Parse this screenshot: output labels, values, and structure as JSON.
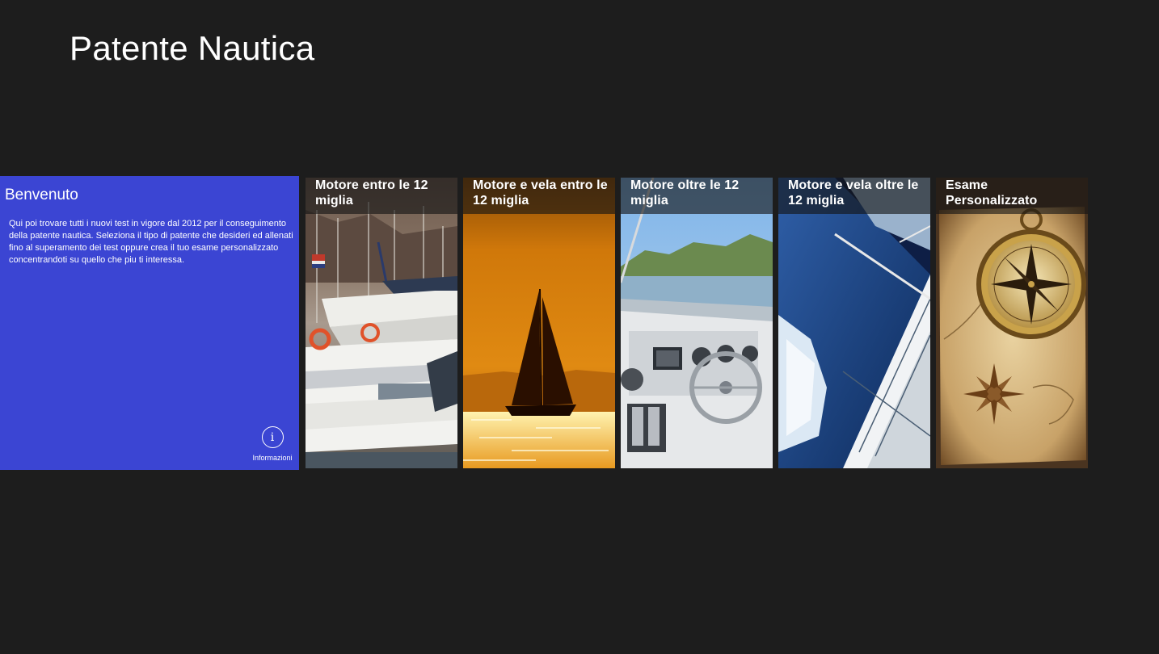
{
  "app": {
    "title": "Patente Nautica"
  },
  "welcome": {
    "title": "Benvenuto",
    "text": "Qui poi trovare tutti i nuovi test in vigore dal 2012 per il conseguimento della patente nautica. Seleziona il tipo di patente che desideri ed allenati fino al superamento dei test oppure crea il tuo esame personalizzato concentrandoti su quello che piu ti interessa.",
    "info_label": "Informazioni",
    "info_glyph": "i",
    "background_color": "#3b45d3"
  },
  "tiles": [
    {
      "label": "Motore entro le 12 miglia",
      "icon": "motor-yacht-photo"
    },
    {
      "label": "Motore e vela entro le 12 miglia",
      "icon": "sailboat-sunset-photo"
    },
    {
      "label": "Motore oltre le 12 miglia",
      "icon": "boat-helm-photo"
    },
    {
      "label": "Motore e vela oltre le 12 miglia",
      "icon": "sailing-hull-waves-photo"
    },
    {
      "label": "Esame Personalizzato",
      "icon": "compass-map-photo"
    }
  ],
  "colors": {
    "background": "#1d1d1d",
    "accent": "#3b45d3",
    "text": "#ffffff"
  }
}
